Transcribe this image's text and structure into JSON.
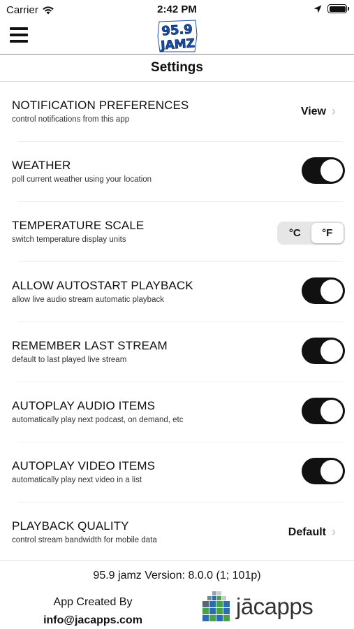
{
  "status_bar": {
    "carrier": "Carrier",
    "time": "2:42 PM"
  },
  "header": {
    "logo_top": "95.9",
    "logo_bottom": "JAMZ",
    "title": "Settings"
  },
  "settings": [
    {
      "title": "NOTIFICATION PREFERENCES",
      "subtitle": "control notifications from this app",
      "control": "link",
      "action_label": "View"
    },
    {
      "title": "WEATHER",
      "subtitle": "poll current weather using your location",
      "control": "toggle",
      "on": true
    },
    {
      "title": "TEMPERATURE SCALE",
      "subtitle": "switch temperature display units",
      "control": "segmented",
      "options": [
        "°C",
        "°F"
      ],
      "selected": "°F"
    },
    {
      "title": "ALLOW AUTOSTART PLAYBACK",
      "subtitle": "allow live audio stream automatic playback",
      "control": "toggle",
      "on": true
    },
    {
      "title": "REMEMBER LAST STREAM",
      "subtitle": "default to last played live stream",
      "control": "toggle",
      "on": true
    },
    {
      "title": "AUTOPLAY AUDIO ITEMS",
      "subtitle": "automatically play next podcast, on demand, etc",
      "control": "toggle",
      "on": true
    },
    {
      "title": "AUTOPLAY VIDEO ITEMS",
      "subtitle": "automatically play next video in a list",
      "control": "toggle",
      "on": true
    },
    {
      "title": "PLAYBACK QUALITY",
      "subtitle": "control stream bandwidth for mobile data",
      "control": "link",
      "action_label": "Default"
    }
  ],
  "footer": {
    "version": "95.9 jamz Version: 8.0.0 (1; 101p)",
    "created_by": "App Created By",
    "email": "info@jacapps.com",
    "brand": "jācapps"
  },
  "colors": {
    "brand_blue": "#1e4fa3",
    "toggle_on": "#111111",
    "jacapps_blue": "#2b6cb0",
    "jacapps_green": "#4aa04a"
  }
}
